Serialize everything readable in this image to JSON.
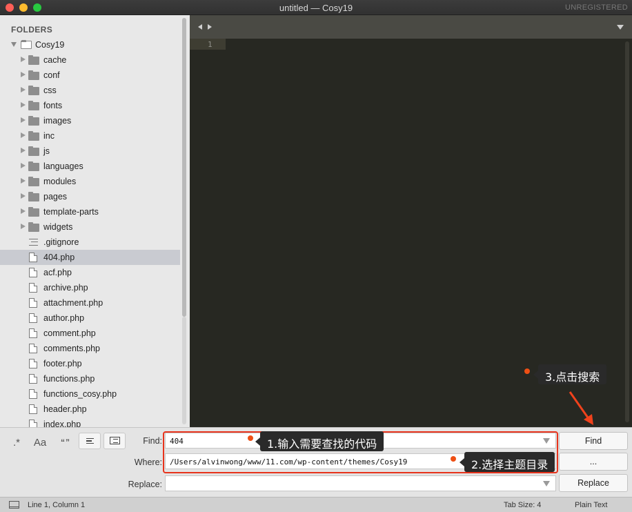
{
  "window": {
    "title": "untitled — Cosy19",
    "unregistered": "UNREGISTERED"
  },
  "sidebar": {
    "heading": "FOLDERS",
    "root": "Cosy19",
    "folders": [
      "cache",
      "conf",
      "css",
      "fonts",
      "images",
      "inc",
      "js",
      "languages",
      "modules",
      "pages",
      "template-parts",
      "widgets"
    ],
    "dotfile": ".gitignore",
    "files": [
      "404.php",
      "acf.php",
      "archive.php",
      "attachment.php",
      "author.php",
      "comment.php",
      "comments.php",
      "footer.php",
      "functions.php",
      "functions_cosy.php",
      "header.php",
      "index.php"
    ],
    "selected": "404.php"
  },
  "editor": {
    "line_number": "1"
  },
  "find_panel": {
    "options": {
      "regex": ".*",
      "case": "Aa",
      "whole_word": "“”"
    },
    "find_label": "Find:",
    "find_value": "404",
    "where_label": "Where:",
    "where_value": "/Users/alvinwong/www/11.com/wp-content/themes/Cosy19",
    "replace_label": "Replace:",
    "replace_value": "",
    "find_button": "Find",
    "browse_button": "...",
    "replace_button": "Replace"
  },
  "annotations": {
    "step1": "1.输入需要查找的代码",
    "step2": "2.选择主题目录",
    "step3": "3.点击搜索",
    "color": "#e8331c"
  },
  "status": {
    "position": "Line 1, Column 1",
    "tab_size": "Tab Size: 4",
    "syntax": "Plain Text"
  }
}
